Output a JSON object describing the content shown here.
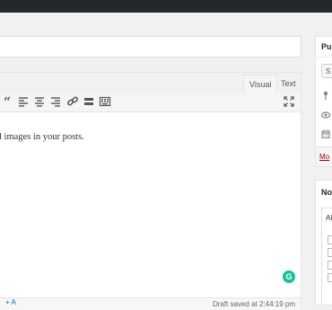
{
  "editor": {
    "tab_visual": "Visual",
    "tab_text": "Text",
    "body_text": "l images in your posts.",
    "draft_status": "Draft saved at 2:44:19 pm"
  },
  "publish": {
    "title": "Pu",
    "save_label": "S",
    "move_to_trash": "Mo"
  },
  "notifications": {
    "title": "No",
    "filter_label": "Al",
    "add_link": "+ A"
  },
  "toolbar_icons": [
    "blockquote-icon",
    "align-left-icon",
    "align-center-icon",
    "align-right-icon",
    "link-icon",
    "read-more-icon",
    "toolbar-toggle-icon"
  ],
  "colors": {
    "grammarly": "#15c39a",
    "trash_link": "#a00000",
    "link": "#0073aa"
  }
}
